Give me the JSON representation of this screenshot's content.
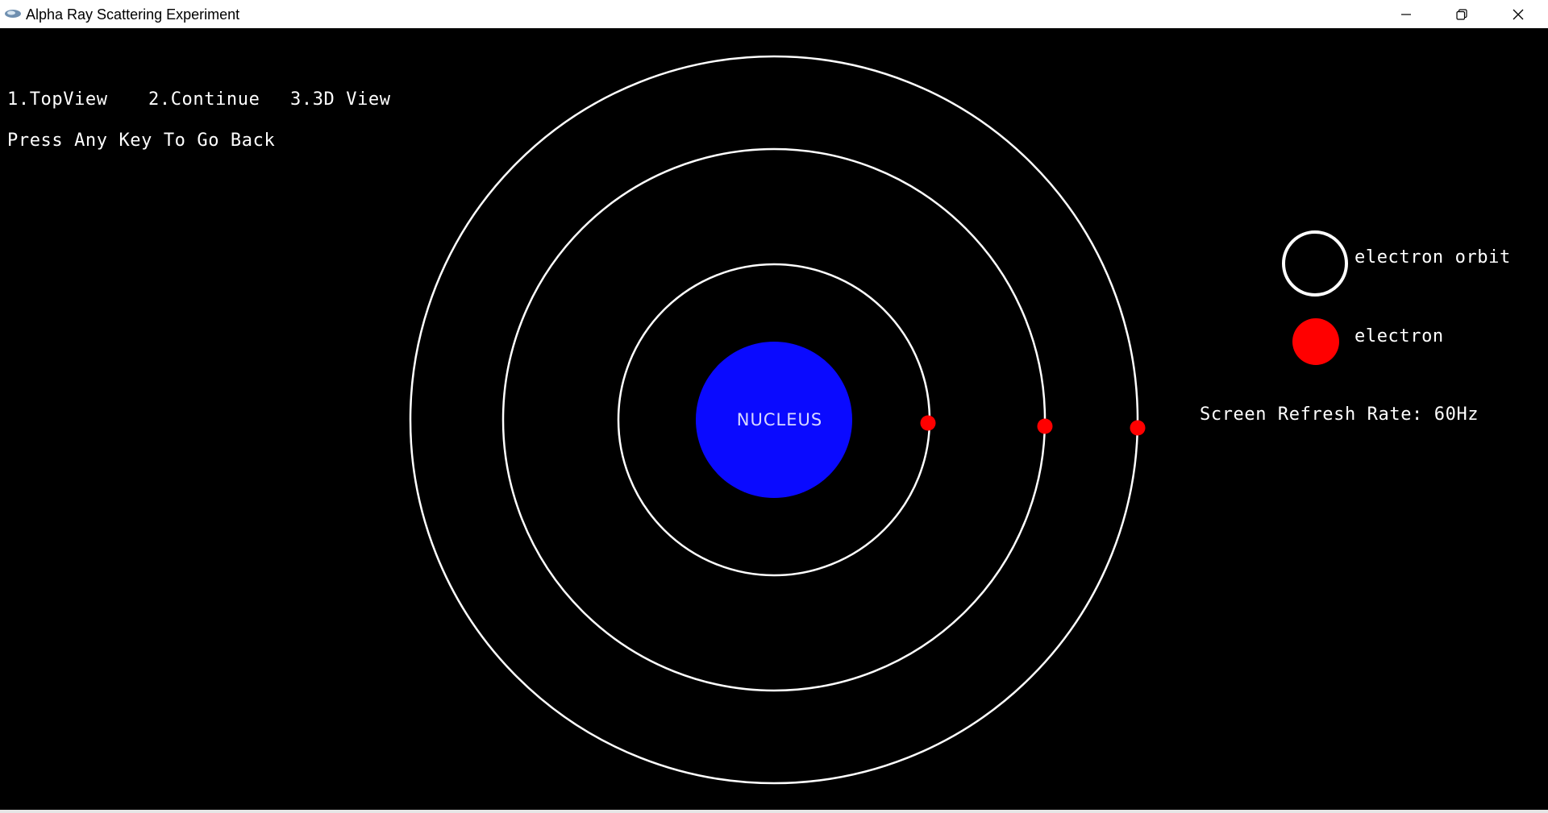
{
  "window": {
    "title": "Alpha Ray Scattering Experiment",
    "controls": {
      "minimize_icon": "minimize-icon",
      "maximize_icon": "restore-icon",
      "close_icon": "close-icon"
    }
  },
  "menu": {
    "items": [
      {
        "label": "1.TopView"
      },
      {
        "label": "2.Continue"
      },
      {
        "label": "3.3D View"
      }
    ],
    "back_hint": "Press Any Key To Go Back"
  },
  "scene": {
    "nucleus": {
      "label": "NUCLEUS",
      "color": "#0a0aff"
    },
    "orbit_color": "#ffffff",
    "electron_color": "#ff0000",
    "orbit_count": 3,
    "electron_count": 3
  },
  "legend": {
    "orbit_label": "electron orbit",
    "electron_label": "electron"
  },
  "status": {
    "refresh_rate": "Screen Refresh Rate: 60Hz"
  }
}
